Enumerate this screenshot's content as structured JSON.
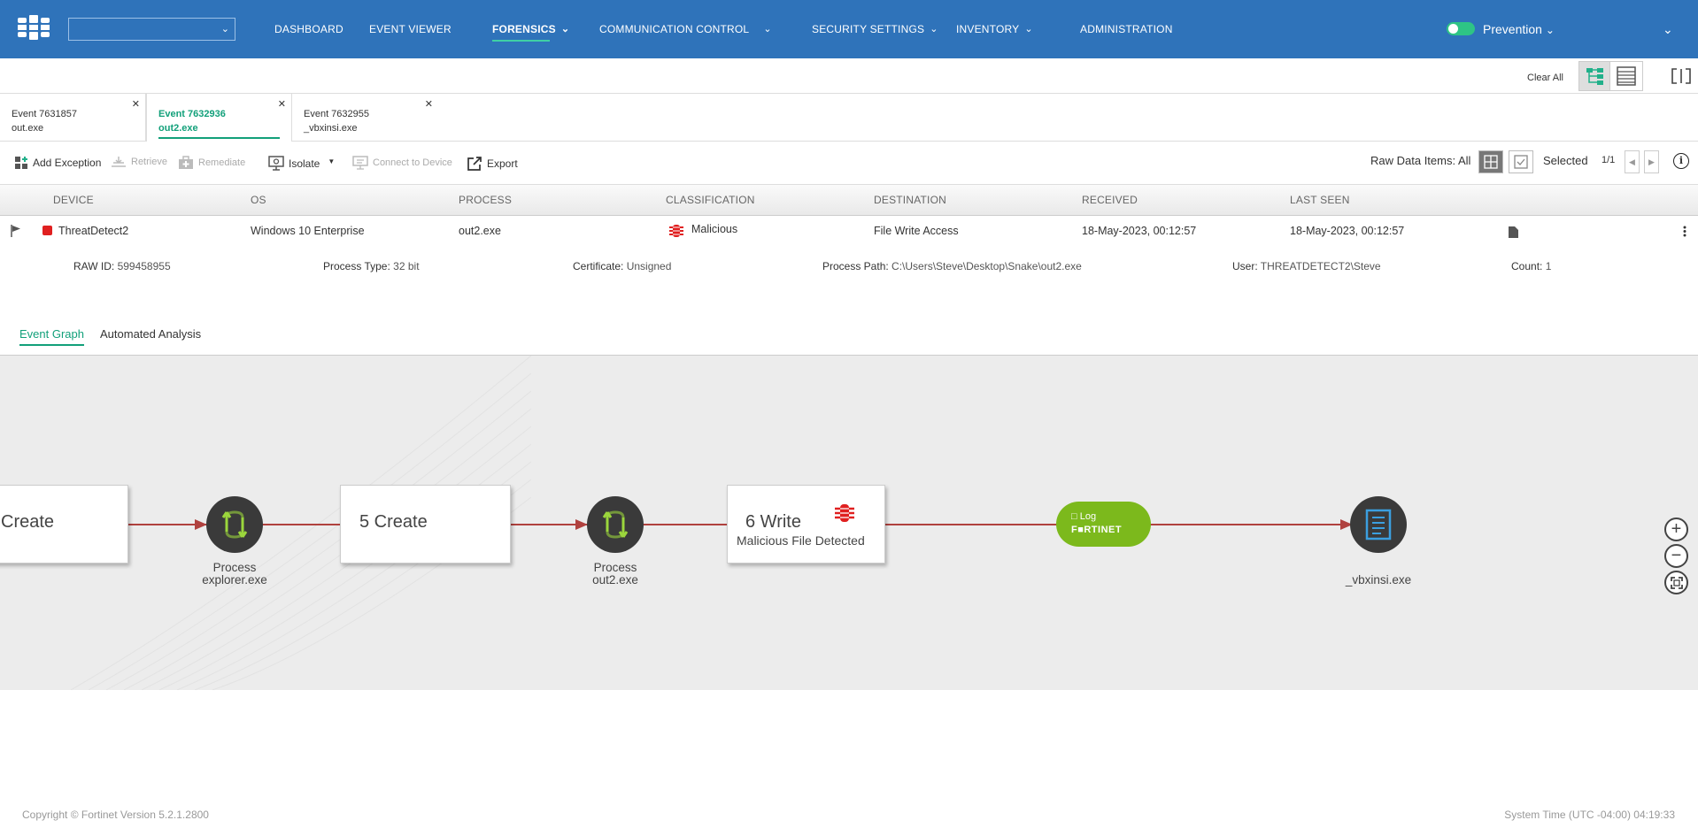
{
  "nav": {
    "items": [
      {
        "label": "DASHBOARD",
        "dropdown": false
      },
      {
        "label": "EVENT VIEWER",
        "dropdown": false
      },
      {
        "label": "FORENSICS",
        "dropdown": true,
        "active": true
      },
      {
        "label": "COMMUNICATION CONTROL",
        "dropdown": true
      },
      {
        "label": "SECURITY SETTINGS",
        "dropdown": true
      },
      {
        "label": "INVENTORY",
        "dropdown": true
      },
      {
        "label": "ADMINISTRATION",
        "dropdown": false
      }
    ],
    "mode_label": "Prevention",
    "mode_enabled": true,
    "org_select_value": ""
  },
  "toolbar": {
    "clear_all": "Clear All"
  },
  "event_tabs": [
    {
      "event": "Event 7631857",
      "file": "out.exe",
      "active": false
    },
    {
      "event": "Event 7632936",
      "file": "out2.exe",
      "active": true
    },
    {
      "event": "Event 7632955",
      "file": "_vbxinsi.exe",
      "active": false
    }
  ],
  "actions": {
    "add_exception": "Add Exception",
    "retrieve": "Retrieve",
    "remediate": "Remediate",
    "isolate": "Isolate",
    "connect_to_device": "Connect to Device",
    "export": "Export",
    "raw_data_items": "Raw Data Items: All",
    "selected": "Selected",
    "pager": "1/1"
  },
  "table": {
    "columns": [
      "DEVICE",
      "OS",
      "PROCESS",
      "CLASSIFICATION",
      "DESTINATION",
      "RECEIVED",
      "LAST SEEN"
    ],
    "row": {
      "device": "ThreatDetect2",
      "os": "Windows 10 Enterprise",
      "process": "out2.exe",
      "classification": "Malicious",
      "destination": "File Write Access",
      "received": "18-May-2023, 00:12:57",
      "last_seen": "18-May-2023, 00:12:57"
    },
    "details": {
      "raw_id_label": "RAW ID:",
      "raw_id": "599458955",
      "process_type_label": "Process Type:",
      "process_type": "32 bit",
      "certificate_label": "Certificate:",
      "certificate": "Unsigned",
      "process_path_label": "Process Path:",
      "process_path": "C:\\Users\\Steve\\Desktop\\Snake\\out2.exe",
      "user_label": "User:",
      "user": "THREATDETECT2\\Steve",
      "count_label": "Count:",
      "count": "1"
    }
  },
  "subtabs": [
    "Event Graph",
    "Automated Analysis"
  ],
  "graph": {
    "create_left": "Create",
    "process1_line1": "Process",
    "process1_line2": "explorer.exe",
    "create5": "5 Create",
    "process2_line1": "Process",
    "process2_line2": "out2.exe",
    "write6": "6 Write",
    "write6_sub": "Malicious File Detected",
    "log_label": "Log",
    "log_brand": "F■RTINET",
    "file_label": "_vbxinsi.exe"
  },
  "footer": {
    "copyright": "Copyright © Fortinet Version 5.2.1.2800",
    "system_time": "System Time (UTC -04:00) 04:19:33"
  },
  "colors": {
    "topbar": "#2f73ba",
    "accent": "#12a07a",
    "edge": "#b0413e",
    "malicious": "#e02020",
    "log": "#7cb91c"
  }
}
